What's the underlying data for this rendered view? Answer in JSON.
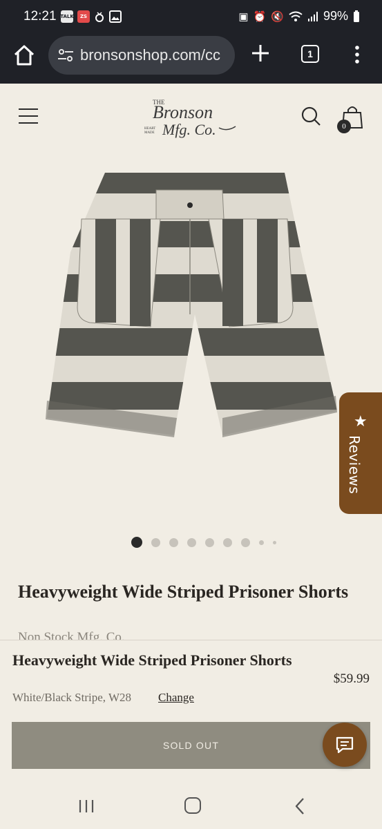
{
  "status": {
    "time": "12:21",
    "battery": "99%",
    "left_icons": [
      "TALK",
      "ZS",
      "ring-icon",
      "image-icon"
    ]
  },
  "browser": {
    "url": "bronsonshop.com/cc",
    "tab_count": "1"
  },
  "header": {
    "logo_text": "THE BRONSON MFG. Co",
    "cart_count": "0"
  },
  "reviews_tab": {
    "label": "Reviews"
  },
  "carousel": {
    "total": 9,
    "active": 0
  },
  "product": {
    "title": "Heavyweight Wide Striped Prisoner Shorts",
    "vendor": "Non Stock Mfg. Co."
  },
  "sticky": {
    "title": "Heavyweight Wide Striped Prisoner Shorts",
    "price": "$59.99",
    "variant": "White/Black Stripe, W28",
    "change_label": "Change",
    "button_label": "SOLD OUT"
  },
  "colors": {
    "background": "#f1ede4",
    "accent_brown": "#7a4b1e",
    "sold_out": "#8f8c80",
    "browser_chrome": "#1f2127"
  }
}
